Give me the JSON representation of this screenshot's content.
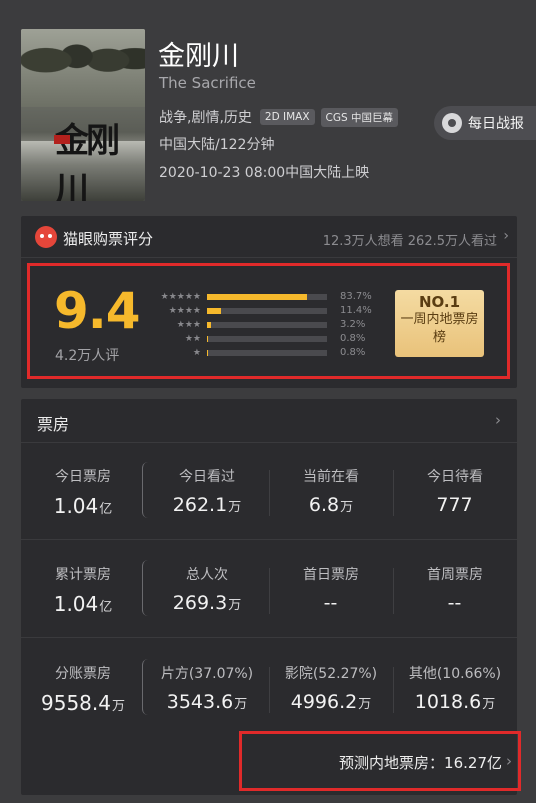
{
  "movie": {
    "title": "金刚川",
    "title_en": "The Sacrifice",
    "genres": "战争,剧情,历史",
    "tags": [
      "2D IMAX",
      "CGS 中国巨幕"
    ],
    "origin_duration": "中国大陆/122分钟",
    "release": "2020-10-23 08:00中国大陆上映",
    "poster_title": "金刚川"
  },
  "daily_report": {
    "label": "每日战报",
    "icon": "medal-icon"
  },
  "rating": {
    "source_label": "猫眼购票评分",
    "stats": "12.3万人想看 262.5万人看过",
    "score": "9.4",
    "count": "4.2万人评",
    "distribution": [
      {
        "stars": 5,
        "percent": 83.7,
        "label": "83.7%"
      },
      {
        "stars": 4,
        "percent": 11.4,
        "label": "11.4%"
      },
      {
        "stars": 3,
        "percent": 3.2,
        "label": "3.2%"
      },
      {
        "stars": 2,
        "percent": 0.8,
        "label": "0.8%"
      },
      {
        "stars": 1,
        "percent": 0.8,
        "label": "0.8%"
      }
    ],
    "rank": {
      "no": "NO.1",
      "text": "一周内地票房榜"
    },
    "accent": "#f6b92c"
  },
  "box_office": {
    "title": "票房",
    "rows": [
      {
        "cells": [
          {
            "label": "今日票房",
            "value": "1.04",
            "unit": "亿"
          },
          {
            "label": "今日看过",
            "value": "262.1",
            "unit": "万"
          },
          {
            "label": "当前在看",
            "value": "6.8",
            "unit": "万"
          },
          {
            "label": "今日待看",
            "value": "777",
            "unit": ""
          }
        ]
      },
      {
        "cells": [
          {
            "label": "累计票房",
            "value": "1.04",
            "unit": "亿"
          },
          {
            "label": "总人次",
            "value": "269.3",
            "unit": "万"
          },
          {
            "label": "首日票房",
            "value": "--",
            "unit": ""
          },
          {
            "label": "首周票房",
            "value": "--",
            "unit": ""
          }
        ]
      },
      {
        "cells": [
          {
            "label": "分账票房",
            "value": "9558.4",
            "unit": "万"
          },
          {
            "label": "片方(37.07%)",
            "value": "3543.6",
            "unit": "万"
          },
          {
            "label": "影院(52.27%)",
            "value": "4996.2",
            "unit": "万"
          },
          {
            "label": "其他(10.66%)",
            "value": "1018.6",
            "unit": "万"
          }
        ]
      }
    ],
    "forecast": "预测内地票房：16.27亿"
  },
  "colors": {
    "highlight": "#e02a2a",
    "background": "#3c3c3e",
    "card": "#2b2b2e"
  }
}
